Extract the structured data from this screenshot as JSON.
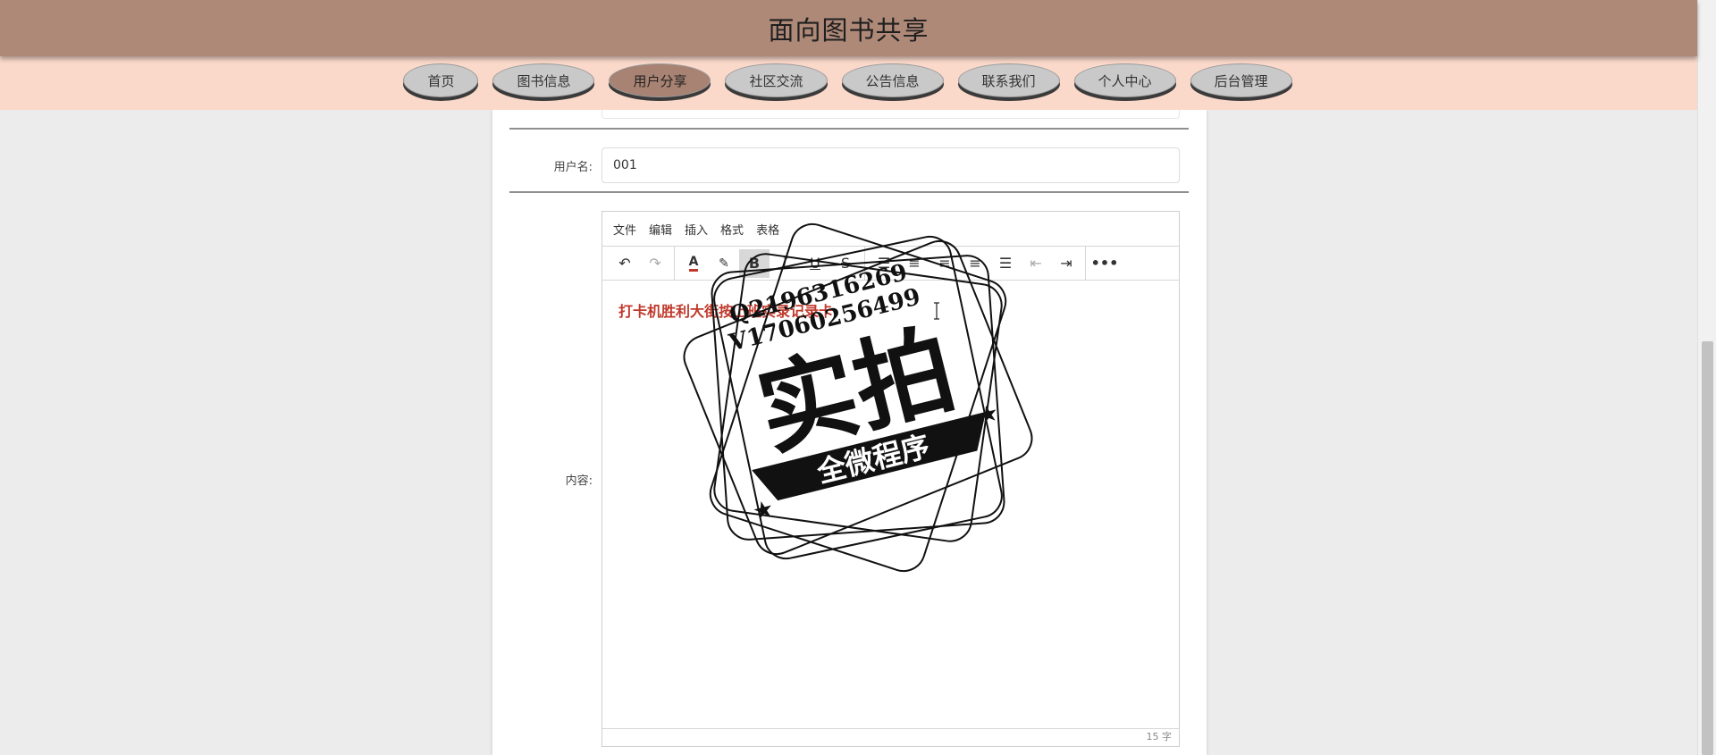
{
  "site": {
    "title": "面向图书共享"
  },
  "nav": {
    "items": [
      {
        "label": "首页"
      },
      {
        "label": "图书信息"
      },
      {
        "label": "用户分享",
        "active": true
      },
      {
        "label": "社区交流"
      },
      {
        "label": "公告信息"
      },
      {
        "label": "联系我们"
      },
      {
        "label": "个人中心"
      },
      {
        "label": "后台管理"
      }
    ]
  },
  "form": {
    "username_label": "用户名:",
    "username_value": "001",
    "content_label": "内容:"
  },
  "editor": {
    "menus": [
      "文件",
      "编辑",
      "插入",
      "格式",
      "表格"
    ],
    "toolbar_icons": [
      "undo-icon",
      "redo-icon",
      "font-color-icon",
      "highlight-icon",
      "bold-icon",
      "italic-icon",
      "underline-icon",
      "strikethrough-icon",
      "list-icon",
      "align-left-icon",
      "align-center-icon",
      "align-right-icon",
      "align-justify-icon",
      "outdent-icon",
      "indent-icon",
      "more-icon"
    ],
    "content_text": "打卡机胜利大街按上班实录记录卡",
    "word_count": "15 字"
  },
  "watermark": {
    "line1": "Q2196316269",
    "line2": "V17060256499",
    "main": "实拍",
    "banner": "全微程序"
  },
  "colors": {
    "title_bar": "#ae8978",
    "nav_bar": "#fbd9ca",
    "nav_active": "#a88373",
    "content_text": "#c0392b"
  }
}
